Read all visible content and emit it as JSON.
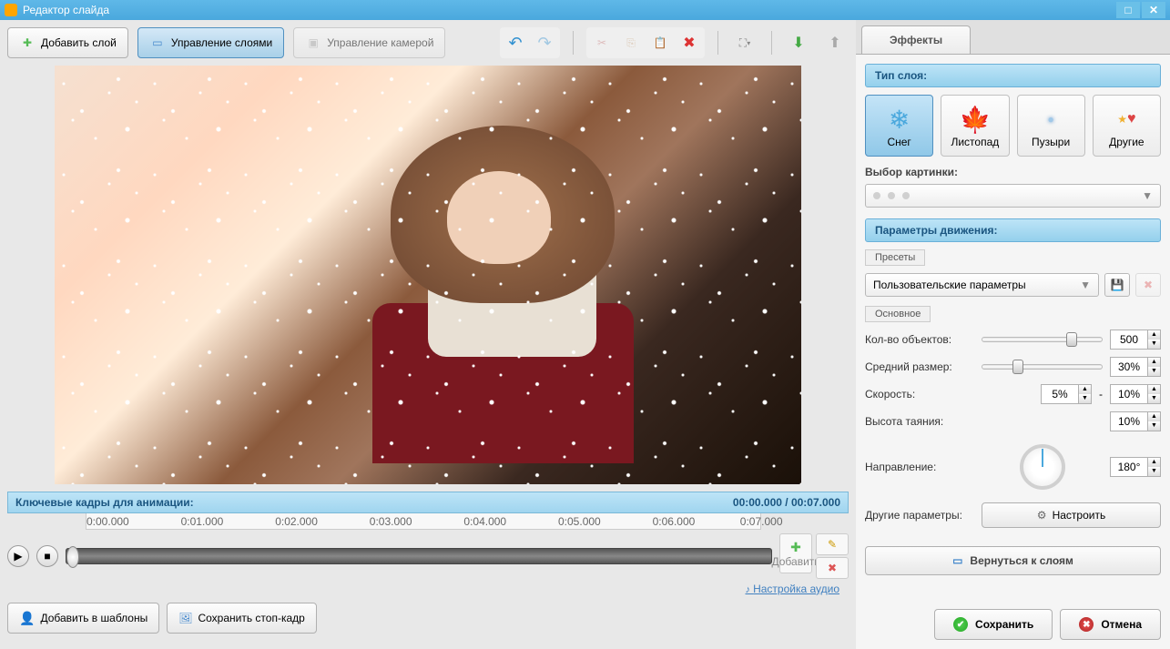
{
  "window": {
    "title": "Редактор слайда"
  },
  "toolbar": {
    "add_layer": "Добавить слой",
    "manage_layers": "Управление слоями",
    "camera_control": "Управление камерой"
  },
  "timeline": {
    "header": "Ключевые кадры для анимации:",
    "time_display": "00:00.000 / 00:07.000",
    "marks": [
      "0:00.000",
      "0:01.000",
      "0:02.000",
      "0:03.000",
      "0:04.000",
      "0:05.000",
      "0:06.000",
      "0:07.000"
    ],
    "add_label": "Добавить",
    "audio_link": "Настройка аудио"
  },
  "footer": {
    "add_template": "Добавить в шаблоны",
    "save_frame": "Сохранить стоп-кадр",
    "save": "Сохранить",
    "cancel": "Отмена"
  },
  "effects": {
    "tab": "Эффекты",
    "layer_type_header": "Тип слоя:",
    "types": [
      {
        "label": "Снег",
        "icon": "❄",
        "color": "#4aa8dd"
      },
      {
        "label": "Листопад",
        "icon": "🍁",
        "color": "#e89830"
      },
      {
        "label": "Пузыри",
        "icon": "●",
        "color": "#a0c8e8"
      },
      {
        "label": "Другие",
        "icon": "★",
        "color": "#f0b030"
      }
    ],
    "image_select_label": "Выбор картинки:",
    "motion_header": "Параметры движения:",
    "presets_label": "Пресеты",
    "preset_value": "Пользовательские параметры",
    "basic_label": "Основное",
    "params": {
      "count_label": "Кол-во объектов:",
      "count_value": "500",
      "size_label": "Средний размер:",
      "size_value": "30%",
      "speed_label": "Скорость:",
      "speed_min": "5%",
      "speed_max": "10%",
      "melt_label": "Высота таяния:",
      "melt_value": "10%",
      "direction_label": "Направление:",
      "direction_value": "180°",
      "other_label": "Другие параметры:",
      "configure": "Настроить"
    },
    "back_to_layers": "Вернуться к слоям"
  }
}
